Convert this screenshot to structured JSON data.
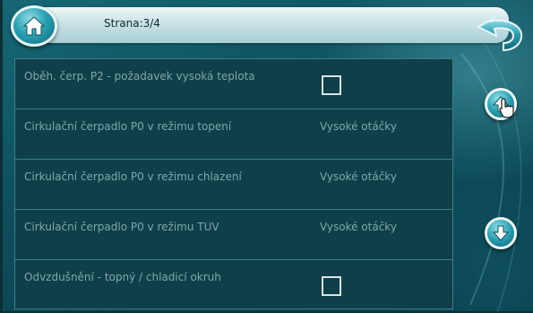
{
  "header": {
    "title": "Strana:3/4",
    "home_icon": "home-icon",
    "back_icon": "back-arrow-icon"
  },
  "rows": [
    {
      "label": "Oběh. čerp. P2 - požadavek vysoká teplota",
      "control": "checkbox",
      "checked": false
    },
    {
      "label": "Cirkulační čerpadlo P0 v režimu topení",
      "value": "Vysoké otáčky"
    },
    {
      "label": "Cirkulační čerpadlo P0 v režimu chlazení",
      "value": "Vysoké otáčky"
    },
    {
      "label": "Cirkulační čerpadlo P0 v režimu TUV",
      "value": "Vysoké otáčky"
    },
    {
      "label": "Odvzdušnění - topný / chladicí okruh",
      "control": "checkbox",
      "checked": false
    }
  ],
  "scroll": {
    "up_icon": "arrow-up-icon",
    "down_icon": "arrow-down-icon"
  },
  "colors": {
    "background": "#0c4d5a",
    "panel": "#0f3f48",
    "grid_line": "#3d7f8c",
    "text": "#7fa7ae",
    "header_bar": "#c9e2e6"
  }
}
